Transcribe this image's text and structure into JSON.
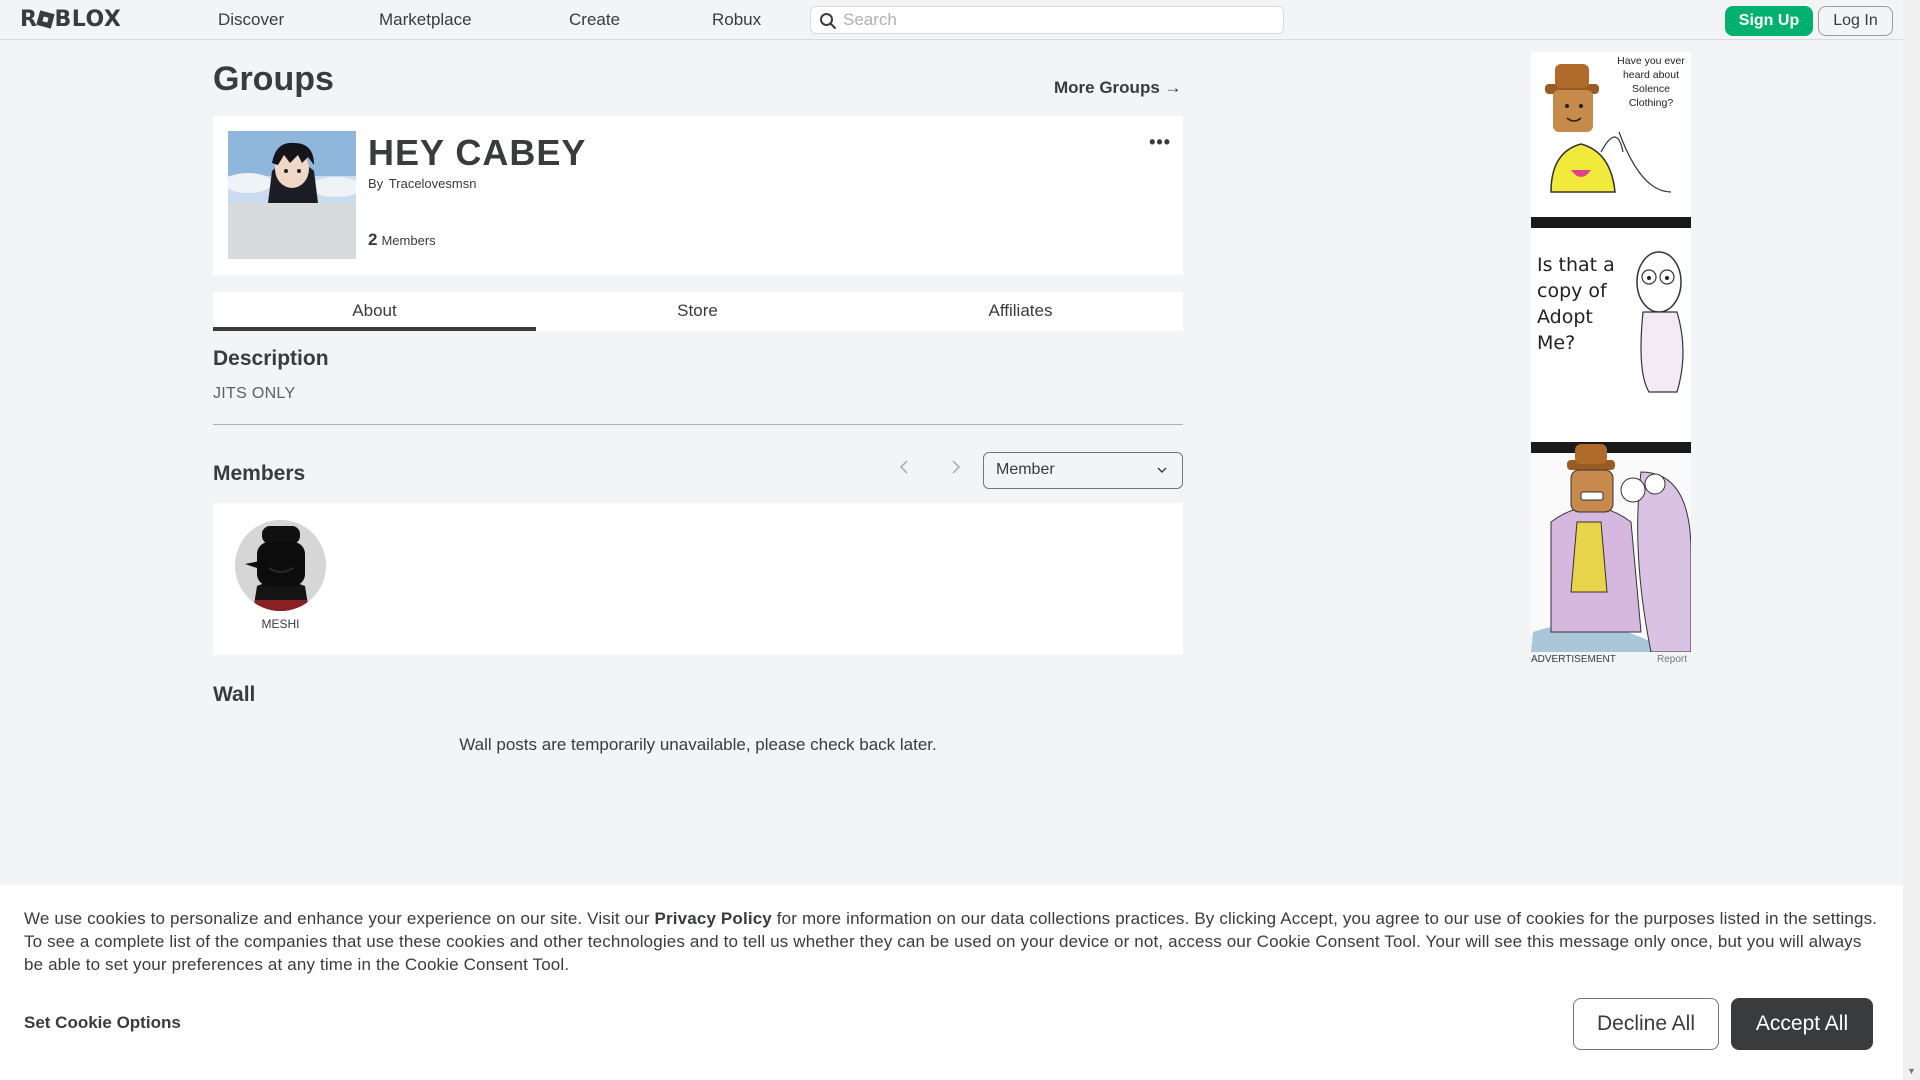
{
  "nav": {
    "logo": "ROBLOX",
    "links": [
      "Discover",
      "Marketplace",
      "Create",
      "Robux"
    ],
    "search_placeholder": "Search",
    "signup_label": "Sign Up",
    "login_label": "Log In"
  },
  "page": {
    "title": "Groups",
    "more_groups_label": "More Groups →"
  },
  "group": {
    "name": "HEY CABEY",
    "by_prefix": "By",
    "owner": "Tracelovesmsn",
    "member_count": "2",
    "members_label": "Members",
    "menu_glyph": "•••"
  },
  "tabs": [
    "About",
    "Store",
    "Affiliates"
  ],
  "about": {
    "description_heading": "Description",
    "description": "JITS ONLY",
    "members_heading": "Members",
    "role_selected": "Member",
    "members": [
      {
        "name": "MESHI"
      }
    ],
    "wall_heading": "Wall",
    "wall_message": "Wall posts are temporarily unavailable, please check back later."
  },
  "ad": {
    "panel1_text": "Have you ever heard about Solence Clothing?",
    "panel2_text": "Is that a copy of Adopt Me?",
    "label": "ADVERTISEMENT",
    "report": "Report"
  },
  "cookie": {
    "text_before_link": "We use cookies to personalize and enhance your experience on our site. Visit our ",
    "link": "Privacy Policy",
    "text_after_link": " for more information on our data collections practices. By clicking Accept, you agree to our use of cookies for the purposes listed in the settings. To see a complete list of the companies that use these cookies and other technologies and to tell us whether they can be used on your device or not, access our Cookie Consent Tool. Your will see this message only once, but you will always be able to set your preferences at any time in the Cookie Consent Tool.",
    "options_label": "Set Cookie Options",
    "decline_label": "Decline All",
    "accept_label": "Accept All"
  },
  "colors": {
    "background": "#f2f4f5",
    "text": "#393b3d",
    "signup_green": "#00b06f",
    "accept_dark": "#393b3d"
  },
  "icons": {
    "search": "search-icon",
    "more": "more-dots-icon",
    "prev": "chevron-left-icon",
    "next": "chevron-right-icon",
    "dropdown": "chevron-down-icon"
  }
}
